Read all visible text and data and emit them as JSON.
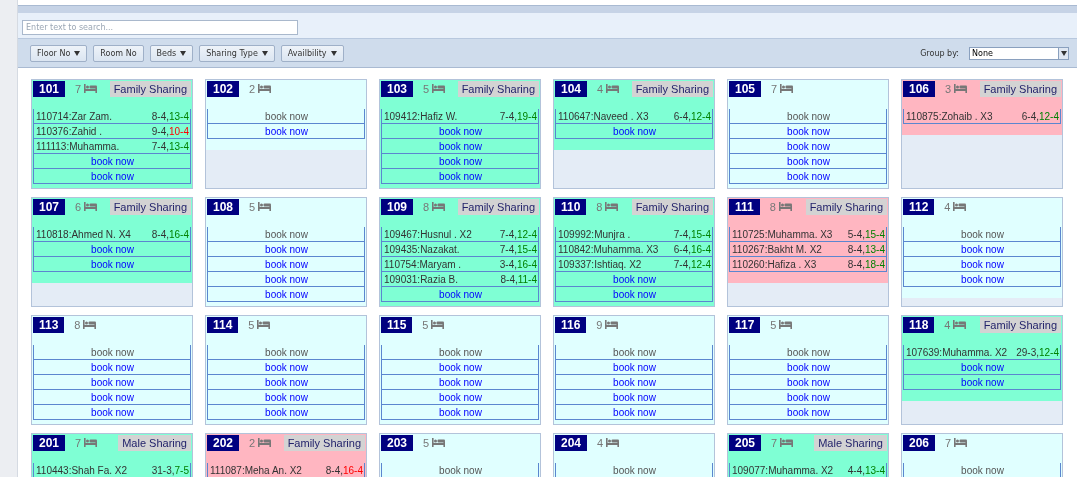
{
  "search": {
    "placeholder": "Enter text to search..."
  },
  "filters": [
    {
      "label": "Floor No",
      "dropdown": true
    },
    {
      "label": "Room No",
      "dropdown": false
    },
    {
      "label": "Beds",
      "dropdown": true
    },
    {
      "label": "Sharing Type",
      "dropdown": true
    },
    {
      "label": "Availbility",
      "dropdown": true
    }
  ],
  "group_by": {
    "label": "Group by:",
    "value": "None"
  },
  "rooms": [
    {
      "number": "101",
      "beds": "7",
      "sharing": "Family Sharing",
      "color": "#7fffd4",
      "rows": [
        {
          "kind": "booking",
          "guest": "110714:Zar Zam.",
          "start": "8-4,",
          "end": "13-4",
          "overdue": false
        },
        {
          "kind": "booking",
          "guest": "110376:Zahid .",
          "start": "9-4,",
          "end": "10-4",
          "overdue": true
        },
        {
          "kind": "booking",
          "guest": "111113:Muhamma.",
          "start": "7-4,",
          "end": "13-4",
          "overdue": false
        },
        {
          "kind": "book",
          "label": "book now",
          "disabled": false
        },
        {
          "kind": "book",
          "label": "book now",
          "disabled": false
        }
      ]
    },
    {
      "number": "102",
      "beds": "2",
      "color": "#e0ffff",
      "rows": [
        {
          "kind": "book",
          "label": "book now",
          "disabled": true
        },
        {
          "kind": "book",
          "label": "book now",
          "disabled": false
        }
      ]
    },
    {
      "number": "103",
      "beds": "5",
      "sharing": "Family Sharing",
      "color": "#7fffd4",
      "rows": [
        {
          "kind": "booking",
          "guest": "109412:Hafiz W.",
          "start": "7-4,",
          "end": "19-4",
          "overdue": false
        },
        {
          "kind": "book",
          "label": "book now",
          "disabled": false
        },
        {
          "kind": "book",
          "label": "book now",
          "disabled": false
        },
        {
          "kind": "book",
          "label": "book now",
          "disabled": false
        },
        {
          "kind": "book",
          "label": "book now",
          "disabled": false
        }
      ]
    },
    {
      "number": "104",
      "beds": "4",
      "sharing": "Family Sharing",
      "color": "#7fffd4",
      "rows": [
        {
          "kind": "booking",
          "guest": "110647:Naveed . X3",
          "start": "6-4,",
          "end": "12-4",
          "overdue": false
        },
        {
          "kind": "book",
          "label": "book now",
          "disabled": false
        }
      ]
    },
    {
      "number": "105",
      "beds": "7",
      "color": "#e0ffff",
      "rows": [
        {
          "kind": "book",
          "label": "book now",
          "disabled": true
        },
        {
          "kind": "book",
          "label": "book now",
          "disabled": false
        },
        {
          "kind": "book",
          "label": "book now",
          "disabled": false
        },
        {
          "kind": "book",
          "label": "book now",
          "disabled": false
        },
        {
          "kind": "book",
          "label": "book now",
          "disabled": false
        }
      ]
    },
    {
      "number": "106",
      "beds": "3",
      "sharing": "Family Sharing",
      "color": "#ffb6c1",
      "rows": [
        {
          "kind": "booking",
          "guest": "110875:Zohaib . X3",
          "start": "6-4,",
          "end": "12-4",
          "overdue": false
        }
      ]
    },
    {
      "number": "107",
      "beds": "6",
      "sharing": "Family Sharing",
      "color": "#7fffd4",
      "rows": [
        {
          "kind": "booking",
          "guest": "110818:Ahmed N. X4",
          "start": "8-4,",
          "end": "16-4",
          "overdue": false
        },
        {
          "kind": "book",
          "label": "book now",
          "disabled": false
        },
        {
          "kind": "book",
          "label": "book now",
          "disabled": false
        }
      ]
    },
    {
      "number": "108",
      "beds": "5",
      "color": "#e0ffff",
      "rows": [
        {
          "kind": "book",
          "label": "book now",
          "disabled": true
        },
        {
          "kind": "book",
          "label": "book now",
          "disabled": false
        },
        {
          "kind": "book",
          "label": "book now",
          "disabled": false
        },
        {
          "kind": "book",
          "label": "book now",
          "disabled": false
        },
        {
          "kind": "book",
          "label": "book now",
          "disabled": false
        }
      ]
    },
    {
      "number": "109",
      "beds": "8",
      "sharing": "Family Sharing",
      "color": "#7fffd4",
      "rows": [
        {
          "kind": "booking",
          "guest": "109467:Husnul . X2",
          "start": "7-4,",
          "end": "12-4",
          "overdue": false
        },
        {
          "kind": "booking",
          "guest": "109435:Nazakat.",
          "start": "7-4,",
          "end": "15-4",
          "overdue": false
        },
        {
          "kind": "booking",
          "guest": "110754:Maryam .",
          "start": "3-4,",
          "end": "16-4",
          "overdue": false
        },
        {
          "kind": "booking",
          "guest": "109031:Razia B.",
          "start": "8-4,",
          "end": "11-4",
          "overdue": false
        },
        {
          "kind": "book",
          "label": "book now",
          "disabled": false
        }
      ]
    },
    {
      "number": "110",
      "beds": "8",
      "sharing": "Family Sharing",
      "color": "#7fffd4",
      "rows": [
        {
          "kind": "booking",
          "guest": "109992:Munjra .",
          "start": "7-4,",
          "end": "15-4",
          "overdue": false
        },
        {
          "kind": "booking",
          "guest": "110842:Muhamma. X3",
          "start": "6-4,",
          "end": "16-4",
          "overdue": false
        },
        {
          "kind": "booking",
          "guest": "109337:Ishtiaq. X2",
          "start": "7-4,",
          "end": "12-4",
          "overdue": false
        },
        {
          "kind": "book",
          "label": "book now",
          "disabled": false
        },
        {
          "kind": "book",
          "label": "book now",
          "disabled": false
        }
      ]
    },
    {
      "number": "111",
      "beds": "8",
      "sharing": "Family Sharing",
      "color": "#ffb6c1",
      "rows": [
        {
          "kind": "booking",
          "guest": "110725:Muhamma. X3",
          "start": "5-4,",
          "end": "15-4",
          "overdue": false
        },
        {
          "kind": "booking",
          "guest": "110267:Bakht M. X2",
          "start": "8-4,",
          "end": "13-4",
          "overdue": false
        },
        {
          "kind": "booking",
          "guest": "110260:Hafiza . X3",
          "start": "8-4,",
          "end": "18-4",
          "overdue": false
        }
      ]
    },
    {
      "number": "112",
      "beds": "4",
      "color": "#e0ffff",
      "rows": [
        {
          "kind": "book",
          "label": "book now",
          "disabled": true
        },
        {
          "kind": "book",
          "label": "book now",
          "disabled": false
        },
        {
          "kind": "book",
          "label": "book now",
          "disabled": false
        },
        {
          "kind": "book",
          "label": "book now",
          "disabled": false
        }
      ]
    },
    {
      "number": "113",
      "beds": "8",
      "color": "#e0ffff",
      "rows": [
        {
          "kind": "book",
          "label": "book now",
          "disabled": true
        },
        {
          "kind": "book",
          "label": "book now",
          "disabled": false
        },
        {
          "kind": "book",
          "label": "book now",
          "disabled": false
        },
        {
          "kind": "book",
          "label": "book now",
          "disabled": false
        },
        {
          "kind": "book",
          "label": "book now",
          "disabled": false
        }
      ]
    },
    {
      "number": "114",
      "beds": "5",
      "color": "#e0ffff",
      "rows": [
        {
          "kind": "book",
          "label": "book now",
          "disabled": true
        },
        {
          "kind": "book",
          "label": "book now",
          "disabled": false
        },
        {
          "kind": "book",
          "label": "book now",
          "disabled": false
        },
        {
          "kind": "book",
          "label": "book now",
          "disabled": false
        },
        {
          "kind": "book",
          "label": "book now",
          "disabled": false
        }
      ]
    },
    {
      "number": "115",
      "beds": "5",
      "color": "#e0ffff",
      "rows": [
        {
          "kind": "book",
          "label": "book now",
          "disabled": true
        },
        {
          "kind": "book",
          "label": "book now",
          "disabled": false
        },
        {
          "kind": "book",
          "label": "book now",
          "disabled": false
        },
        {
          "kind": "book",
          "label": "book now",
          "disabled": false
        },
        {
          "kind": "book",
          "label": "book now",
          "disabled": false
        }
      ]
    },
    {
      "number": "116",
      "beds": "9",
      "color": "#e0ffff",
      "rows": [
        {
          "kind": "book",
          "label": "book now",
          "disabled": true
        },
        {
          "kind": "book",
          "label": "book now",
          "disabled": false
        },
        {
          "kind": "book",
          "label": "book now",
          "disabled": false
        },
        {
          "kind": "book",
          "label": "book now",
          "disabled": false
        },
        {
          "kind": "book",
          "label": "book now",
          "disabled": false
        }
      ]
    },
    {
      "number": "117",
      "beds": "5",
      "color": "#e0ffff",
      "rows": [
        {
          "kind": "book",
          "label": "book now",
          "disabled": true
        },
        {
          "kind": "book",
          "label": "book now",
          "disabled": false
        },
        {
          "kind": "book",
          "label": "book now",
          "disabled": false
        },
        {
          "kind": "book",
          "label": "book now",
          "disabled": false
        },
        {
          "kind": "book",
          "label": "book now",
          "disabled": false
        }
      ]
    },
    {
      "number": "118",
      "beds": "4",
      "sharing": "Family Sharing",
      "color": "#7fffd4",
      "rows": [
        {
          "kind": "booking",
          "guest": "107639:Muhamma. X2",
          "start": "29-3,",
          "end": "12-4",
          "overdue": false
        },
        {
          "kind": "book",
          "label": "book now",
          "disabled": false
        },
        {
          "kind": "book",
          "label": "book now",
          "disabled": false
        }
      ]
    },
    {
      "number": "201",
      "beds": "7",
      "sharing": "Male Sharing",
      "color": "#7fffd4",
      "rows": [
        {
          "kind": "booking",
          "guest": "110443:Shah Fa. X2",
          "start": "31-3,",
          "end": "7-5",
          "overdue": false
        }
      ]
    },
    {
      "number": "202",
      "beds": "2",
      "sharing": "Family Sharing",
      "color": "#ffb6c1",
      "rows": [
        {
          "kind": "booking",
          "guest": "111087:Meha An. X2",
          "start": "8-4,",
          "end": "16-4",
          "overdue": true
        }
      ]
    },
    {
      "number": "203",
      "beds": "5",
      "color": "#e0ffff",
      "rows": [
        {
          "kind": "book",
          "label": "book now",
          "disabled": true
        }
      ]
    },
    {
      "number": "204",
      "beds": "4",
      "color": "#e0ffff",
      "rows": [
        {
          "kind": "book",
          "label": "book now",
          "disabled": true
        }
      ]
    },
    {
      "number": "205",
      "beds": "7",
      "sharing": "Male Sharing",
      "color": "#7fffd4",
      "rows": [
        {
          "kind": "booking",
          "guest": "109077:Muhamma. X2",
          "start": "4-4,",
          "end": "13-4",
          "overdue": false
        }
      ]
    },
    {
      "number": "206",
      "beds": "7",
      "color": "#e0ffff",
      "rows": [
        {
          "kind": "book",
          "label": "book now",
          "disabled": true
        }
      ]
    }
  ]
}
